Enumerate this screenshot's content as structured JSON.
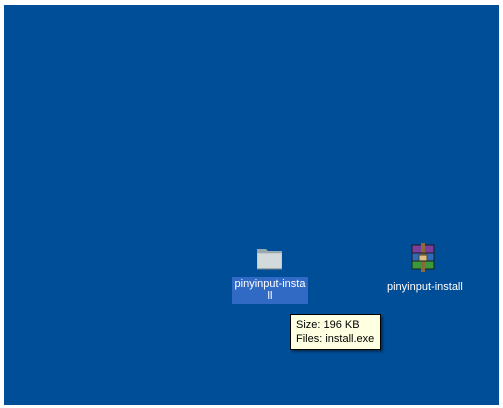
{
  "desktop": {
    "background_color": "#004e98",
    "selection_color": "#316ac5",
    "icons": [
      {
        "label": "pinyinput-install",
        "icon": "folder-icon",
        "selected": true
      },
      {
        "label": "pinyinput-install",
        "icon": "winrar-archive-icon",
        "selected": false
      }
    ]
  },
  "tooltip": {
    "size_line": "Size: 196 KB",
    "files_line": "Files: install.exe",
    "background_color": "#ffffe1"
  }
}
